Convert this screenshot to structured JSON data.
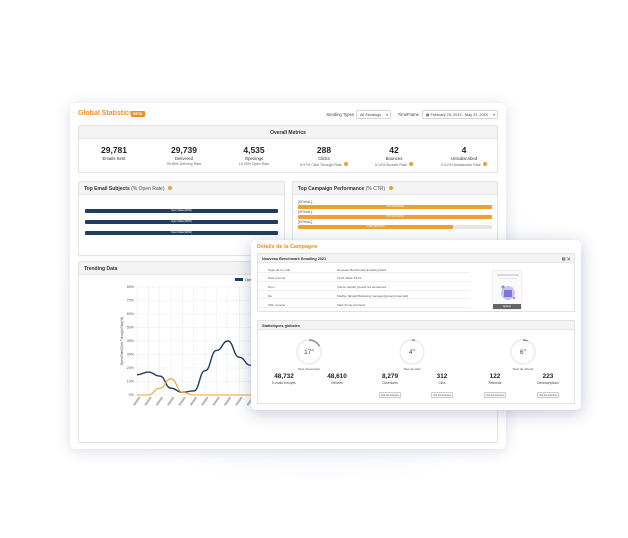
{
  "header": {
    "title": "Global Statistics",
    "beta_badge": "BETA",
    "sending_types_label": "Sending Types",
    "sending_types_value": "All Sendings",
    "timeframe_label": "TimeFrame",
    "timeframe_value": "February 23, 2019 - May 22, 2019"
  },
  "overall_metrics": {
    "title": "Overall Metrics",
    "items": [
      {
        "value": "29,781",
        "label": "Emails Sent",
        "rate": ""
      },
      {
        "value": "29,739",
        "label": "Delivered",
        "rate": "99.86% Delivery Rate"
      },
      {
        "value": "4,535",
        "label": "Openings",
        "rate": "15.25% Open Rate"
      },
      {
        "value": "288",
        "label": "Clicks",
        "rate": "6.97% Click Through Rate"
      },
      {
        "value": "42",
        "label": "Bounces",
        "rate": "0.14% Bounce Rate"
      },
      {
        "value": "4",
        "label": "Unsubscribed",
        "rate": "0.01% Unsubscribe Rate"
      }
    ]
  },
  "top_subjects": {
    "title": "Top Email Subjects",
    "subtitle": "(% Open Rate)",
    "bars": [
      {
        "text": "Open Rate(100%)",
        "fraction": 1.0
      },
      {
        "text": "Open Rate(100%)",
        "fraction": 1.0
      },
      {
        "text": "Open Rate(100%)",
        "fraction": 1.0
      }
    ]
  },
  "top_campaigns": {
    "title": "Top Campaign Performance",
    "subtitle": "(% CTR)",
    "bars": [
      {
        "label": "[SField1],",
        "text": "CTR (100.00%)",
        "fraction": 1.0
      },
      {
        "label": "[SField1],",
        "text": "CTR (100.00%)",
        "fraction": 1.0
      },
      {
        "label": "[SField1],",
        "text": "CTR (100.00%)",
        "fraction": 0.8
      }
    ]
  },
  "trending": {
    "title": "Trending Data",
    "legend": "Open Rate"
  },
  "colors": {
    "accent": "#e8912c",
    "navy": "#1d3d63",
    "orange": "#f0a030"
  },
  "chart_data": {
    "type": "line",
    "title": "Trending Data",
    "ylabel": "Open Rate/Click Through Rate(%)",
    "ylim": [
      0,
      80
    ],
    "yticks": [
      "0%",
      "10%",
      "20%",
      "30%",
      "40%",
      "50%",
      "60%",
      "70%",
      "80%"
    ],
    "series": [
      {
        "name": "Open Rate",
        "color": "#1d3d63",
        "values": [
          15,
          17,
          14,
          5,
          2,
          3,
          18,
          33,
          40,
          28,
          22,
          40,
          30,
          20,
          25,
          40,
          30,
          38,
          32,
          34,
          30,
          35,
          31,
          28,
          33,
          30,
          26,
          31,
          36,
          28,
          33,
          30
        ]
      },
      {
        "name": "",
        "color": "#f0a030",
        "values": [
          0,
          0,
          5,
          12,
          2,
          0,
          0,
          0,
          0,
          0,
          0,
          2,
          10,
          8,
          0,
          0,
          1,
          48,
          54,
          10,
          0,
          3,
          18,
          55,
          20,
          2,
          0,
          0,
          0,
          1,
          0,
          0
        ]
      }
    ]
  },
  "overlay": {
    "title": "Détails de la Campagne",
    "campaign_name": "Nouveau Benchmark Emailing 2021",
    "rows": [
      {
        "key": "Sujet de l'e-mail",
        "value": "Nouveau Benchmark Emailing 2021"
      },
      {
        "key": "Date d'envoi",
        "value": "12.01.2022 19:21"
      },
      {
        "key": "Nom",
        "value": "[Vente rapide] Quand les tendances"
      },
      {
        "key": "De",
        "value": "Madlyn (Email Marketing manager)[email protected]"
      },
      {
        "key": "URL ouverte",
        "value": "https://cmp.io/cmpsp"
      }
    ],
    "thumb_button": "Aperçu",
    "stats_title": "Statistiques globales",
    "donuts": [
      {
        "value": "17",
        "label": "Taux d'ouverture",
        "fraction": 0.17
      },
      {
        "value": "4",
        "label": "Taux de clics",
        "fraction": 0.04
      },
      {
        "value": "6",
        "label": "Taux de rebond",
        "fraction": 0.06
      }
    ],
    "stats": [
      {
        "value": "48,732",
        "label": "E-mails envoyés",
        "button": ""
      },
      {
        "value": "48,610",
        "label": "Délivrés",
        "button": ""
      },
      {
        "value": "8,279",
        "label": "Ouvertures",
        "button": "Voir les données"
      },
      {
        "value": "312",
        "label": "Clics",
        "button": "Voir les données"
      },
      {
        "value": "122",
        "label": "Rebonds",
        "button": "Voir les données"
      },
      {
        "value": "223",
        "label": "Désinscriptions",
        "button": "Voir les données"
      }
    ]
  }
}
